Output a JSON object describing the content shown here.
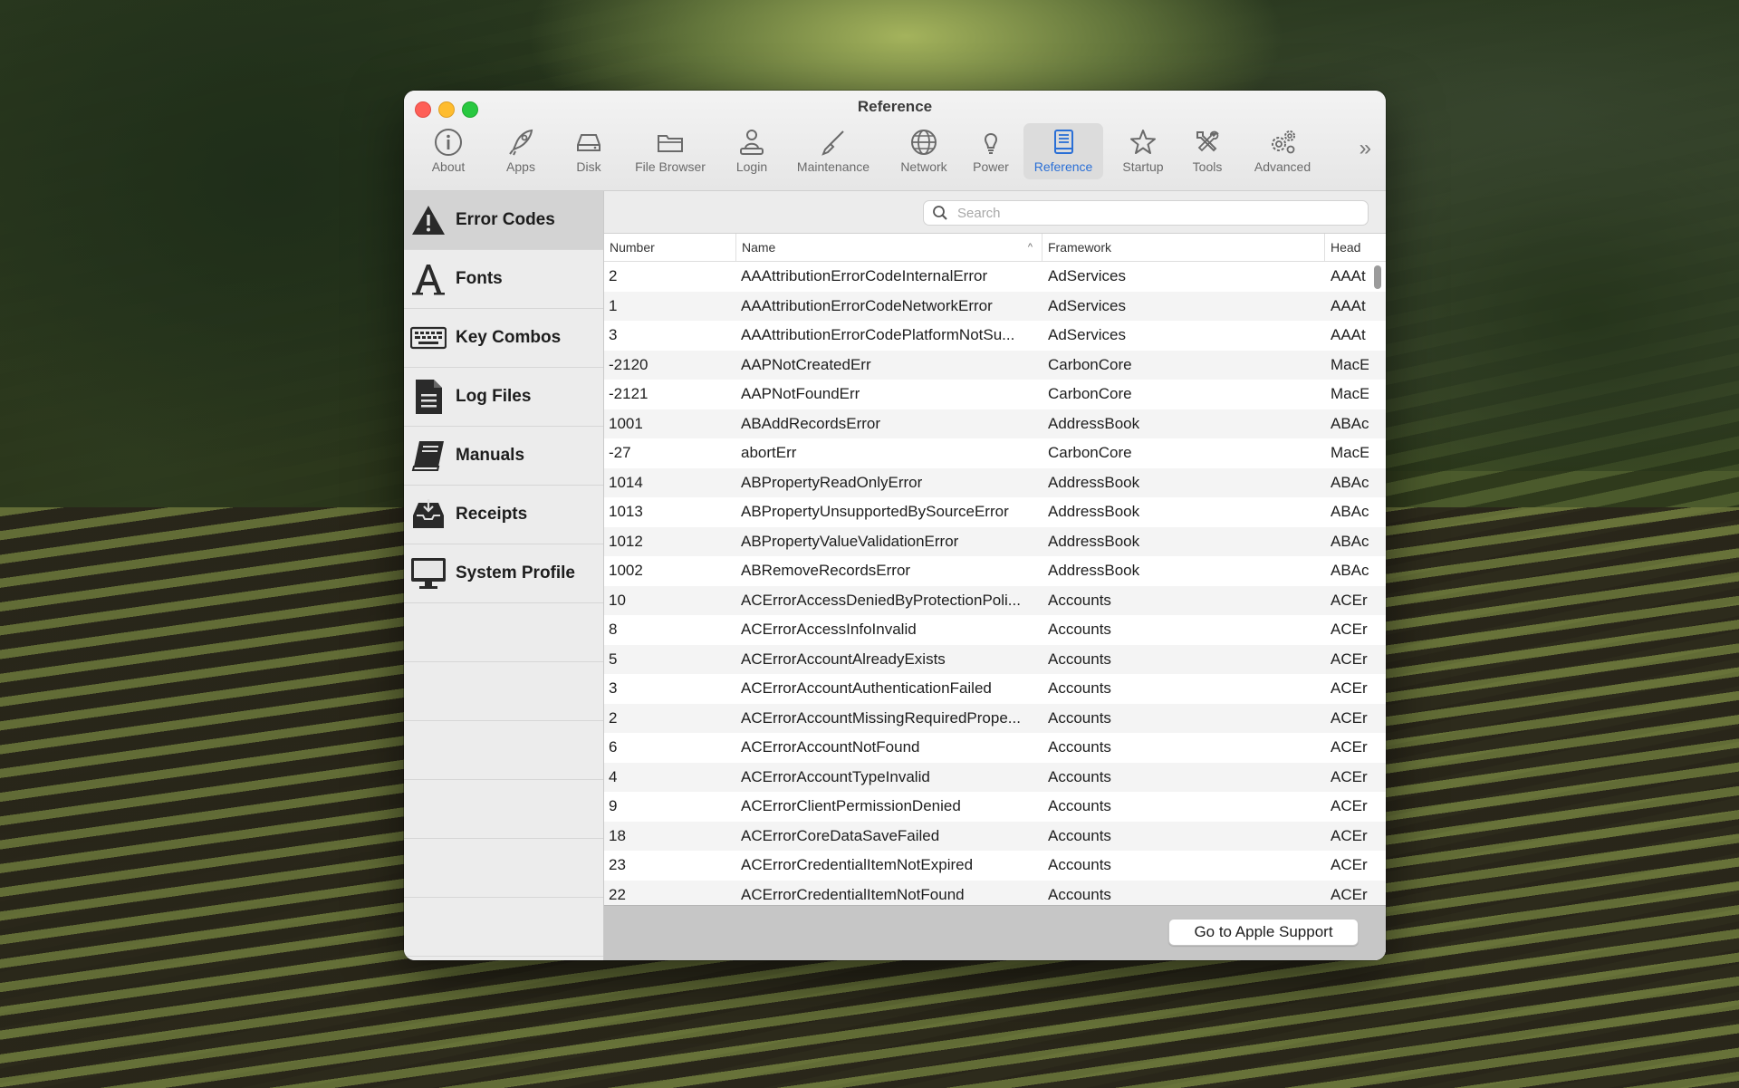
{
  "window": {
    "title": "Reference"
  },
  "toolbar": {
    "items": [
      {
        "label": "About",
        "icon": "info-icon"
      },
      {
        "label": "Apps",
        "icon": "rocket-icon"
      },
      {
        "label": "Disk",
        "icon": "disk-icon"
      },
      {
        "label": "File Browser",
        "icon": "folder-icon"
      },
      {
        "label": "Login",
        "icon": "person-icon"
      },
      {
        "label": "Maintenance",
        "icon": "broom-icon"
      },
      {
        "label": "Network",
        "icon": "globe-icon"
      },
      {
        "label": "Power",
        "icon": "lightbulb-icon"
      },
      {
        "label": "Reference",
        "icon": "book-icon",
        "active": true
      },
      {
        "label": "Startup",
        "icon": "star-icon"
      },
      {
        "label": "Tools",
        "icon": "tools-icon"
      },
      {
        "label": "Advanced",
        "icon": "gears-icon"
      }
    ],
    "overflow": "»"
  },
  "sidebar": {
    "items": [
      {
        "label": "Error Codes",
        "icon": "warning-icon",
        "active": true
      },
      {
        "label": "Fonts",
        "icon": "font-icon"
      },
      {
        "label": "Key Combos",
        "icon": "keyboard-icon"
      },
      {
        "label": "Log Files",
        "icon": "document-icon"
      },
      {
        "label": "Manuals",
        "icon": "manual-icon"
      },
      {
        "label": "Receipts",
        "icon": "inbox-icon"
      },
      {
        "label": "System Profile",
        "icon": "monitor-icon"
      }
    ]
  },
  "search": {
    "placeholder": "Search",
    "value": ""
  },
  "table": {
    "columns": [
      "Number",
      "Name",
      "Framework",
      "Head"
    ],
    "sort_indicator": "^",
    "rows": [
      [
        "2",
        "AAAttributionErrorCodeInternalError",
        "AdServices",
        "AAAt"
      ],
      [
        "1",
        "AAAttributionErrorCodeNetworkError",
        "AdServices",
        "AAAt"
      ],
      [
        "3",
        "AAAttributionErrorCodePlatformNotSu...",
        "AdServices",
        "AAAt"
      ],
      [
        "-2120",
        "AAPNotCreatedErr",
        "CarbonCore",
        "MacE"
      ],
      [
        "-2121",
        "AAPNotFoundErr",
        "CarbonCore",
        "MacE"
      ],
      [
        "1001",
        "ABAddRecordsError",
        "AddressBook",
        "ABAc"
      ],
      [
        "-27",
        "abortErr",
        "CarbonCore",
        "MacE"
      ],
      [
        "1014",
        "ABPropertyReadOnlyError",
        "AddressBook",
        "ABAc"
      ],
      [
        "1013",
        "ABPropertyUnsupportedBySourceError",
        "AddressBook",
        "ABAc"
      ],
      [
        "1012",
        "ABPropertyValueValidationError",
        "AddressBook",
        "ABAc"
      ],
      [
        "1002",
        "ABRemoveRecordsError",
        "AddressBook",
        "ABAc"
      ],
      [
        "10",
        "ACErrorAccessDeniedByProtectionPoli...",
        "Accounts",
        "ACEr"
      ],
      [
        "8",
        "ACErrorAccessInfoInvalid",
        "Accounts",
        "ACEr"
      ],
      [
        "5",
        "ACErrorAccountAlreadyExists",
        "Accounts",
        "ACEr"
      ],
      [
        "3",
        "ACErrorAccountAuthenticationFailed",
        "Accounts",
        "ACEr"
      ],
      [
        "2",
        "ACErrorAccountMissingRequiredPrope...",
        "Accounts",
        "ACEr"
      ],
      [
        "6",
        "ACErrorAccountNotFound",
        "Accounts",
        "ACEr"
      ],
      [
        "4",
        "ACErrorAccountTypeInvalid",
        "Accounts",
        "ACEr"
      ],
      [
        "9",
        "ACErrorClientPermissionDenied",
        "Accounts",
        "ACEr"
      ],
      [
        "18",
        "ACErrorCoreDataSaveFailed",
        "Accounts",
        "ACEr"
      ],
      [
        "23",
        "ACErrorCredentialItemNotExpired",
        "Accounts",
        "ACEr"
      ],
      [
        "22",
        "ACErrorCredentialItemNotFound",
        "Accounts",
        "ACEr"
      ]
    ]
  },
  "footer": {
    "support_button": "Go to Apple Support"
  },
  "colors": {
    "accent": "#2a6fd6",
    "close": "#fe5f57",
    "minimize": "#febc2e",
    "maximize": "#28c840"
  }
}
